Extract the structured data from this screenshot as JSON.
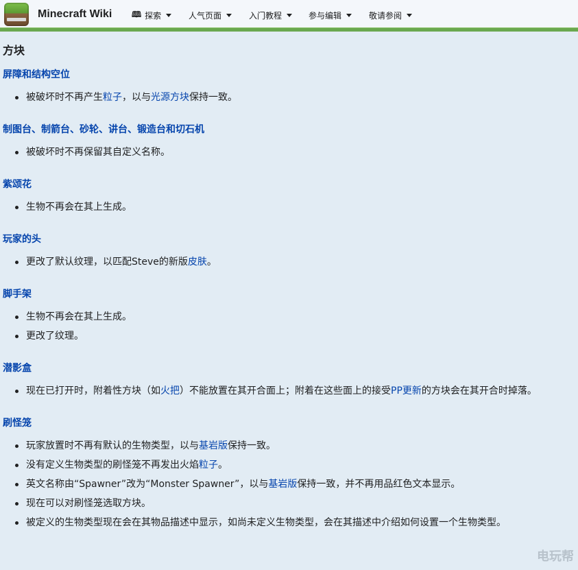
{
  "header": {
    "site_title": "Minecraft Wiki",
    "nav": [
      {
        "label": "探索",
        "icon": "book-icon"
      },
      {
        "label": "人气页面"
      },
      {
        "label": "入门教程"
      },
      {
        "label": "参与编辑"
      },
      {
        "label": "敬请参阅"
      }
    ]
  },
  "section_title": "方块",
  "blocks": [
    {
      "title": "屏障和结构空位",
      "items": [
        {
          "parts": [
            {
              "t": "被破坏时不再产生"
            },
            {
              "t": "粒子",
              "link": true
            },
            {
              "t": "，以与"
            },
            {
              "t": "光源方块",
              "link": true
            },
            {
              "t": "保持一致。"
            }
          ]
        }
      ]
    },
    {
      "title": "制图台、制箭台、砂轮、讲台、锻造台和切石机",
      "items": [
        {
          "parts": [
            {
              "t": "被破坏时不再保留其自定义名称。"
            }
          ]
        }
      ]
    },
    {
      "title": "紫颂花",
      "items": [
        {
          "parts": [
            {
              "t": "生物不再会在其上生成。"
            }
          ]
        }
      ]
    },
    {
      "title": "玩家的头",
      "items": [
        {
          "parts": [
            {
              "t": "更改了默认纹理，以匹配Steve的新版"
            },
            {
              "t": "皮肤",
              "link": true
            },
            {
              "t": "。"
            }
          ]
        }
      ]
    },
    {
      "title": "脚手架",
      "items": [
        {
          "parts": [
            {
              "t": "生物不再会在其上生成。"
            }
          ]
        },
        {
          "parts": [
            {
              "t": "更改了纹理。"
            }
          ]
        }
      ]
    },
    {
      "title": "潜影盒",
      "items": [
        {
          "parts": [
            {
              "t": "现在已打开时，附着性方块（如"
            },
            {
              "t": "火把",
              "link": true
            },
            {
              "t": "）不能放置在其开合面上；附着在这些面上的接受"
            },
            {
              "t": "PP更新",
              "link": true
            },
            {
              "t": "的方块会在其开合时掉落。"
            }
          ]
        }
      ]
    },
    {
      "title": "刷怪笼",
      "items": [
        {
          "parts": [
            {
              "t": "玩家放置时不再有默认的生物类型，以与"
            },
            {
              "t": "基岩版",
              "link": true
            },
            {
              "t": "保持一致。"
            }
          ]
        },
        {
          "parts": [
            {
              "t": "没有定义生物类型的刷怪笼不再发出火焰"
            },
            {
              "t": "粒子",
              "link": true
            },
            {
              "t": "。"
            }
          ]
        },
        {
          "parts": [
            {
              "t": "英文名称由“Spawner”改为“Monster Spawner”，以与"
            },
            {
              "t": "基岩版",
              "link": true
            },
            {
              "t": "保持一致，并不再用品红色文本显示。"
            }
          ]
        },
        {
          "parts": [
            {
              "t": "现在可以对刷怪笼选取方块。"
            }
          ]
        },
        {
          "parts": [
            {
              "t": "被定义的生物类型现在会在其物品描述中显示，如尚未定义生物类型，会在其描述中介绍如何设置一个生物类型。"
            }
          ]
        }
      ]
    }
  ],
  "watermark": "电玩帮"
}
